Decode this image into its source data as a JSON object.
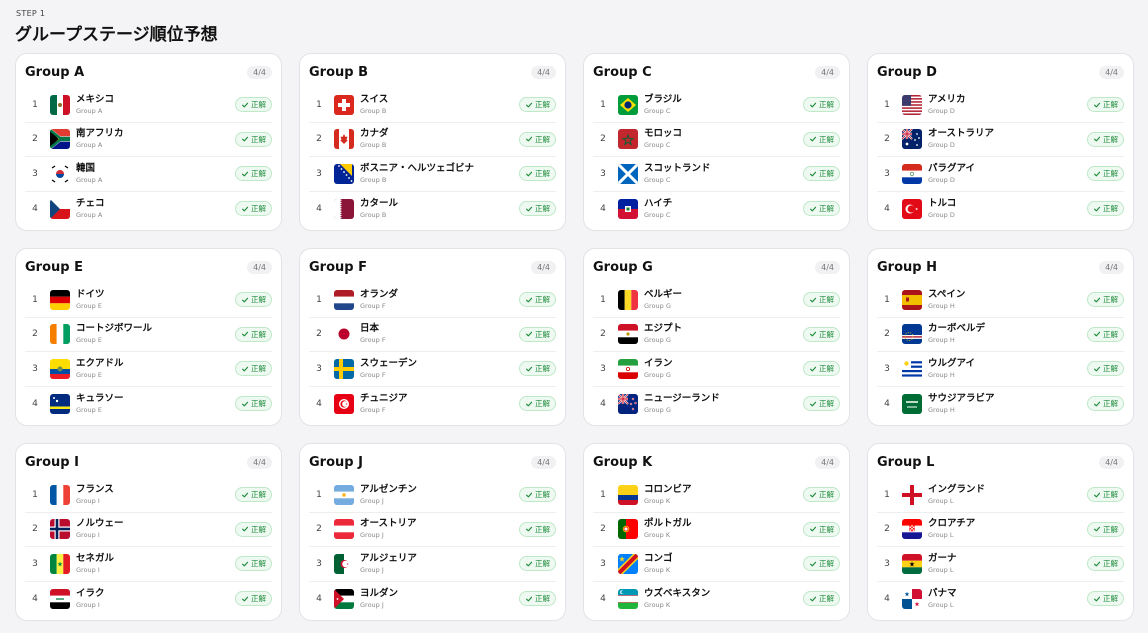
{
  "header": {
    "step": "STEP 1",
    "title": "グループステージ順位予想"
  },
  "status_colors": {
    "correct_text": "#1d8a3a",
    "correct_bg": "#eefaf1",
    "correct_border": "#bfe8c9"
  },
  "groups": [
    {
      "name": "Group A",
      "count": "4/4",
      "teams": [
        {
          "rank": "1",
          "name": "メキシコ",
          "group": "Group A",
          "flag": "mexico",
          "status": "正解"
        },
        {
          "rank": "2",
          "name": "南アフリカ",
          "group": "Group A",
          "flag": "south-africa",
          "status": "正解"
        },
        {
          "rank": "3",
          "name": "韓国",
          "group": "Group A",
          "flag": "south-korea",
          "status": "正解"
        },
        {
          "rank": "4",
          "name": "チェコ",
          "group": "Group A",
          "flag": "czechia",
          "status": "正解"
        }
      ]
    },
    {
      "name": "Group B",
      "count": "4/4",
      "teams": [
        {
          "rank": "1",
          "name": "スイス",
          "group": "Group B",
          "flag": "switzerland",
          "status": "正解"
        },
        {
          "rank": "2",
          "name": "カナダ",
          "group": "Group B",
          "flag": "canada",
          "status": "正解"
        },
        {
          "rank": "3",
          "name": "ボスニア・ヘルツェゴビナ",
          "group": "Group B",
          "flag": "bosnia",
          "status": "正解"
        },
        {
          "rank": "4",
          "name": "カタール",
          "group": "Group B",
          "flag": "qatar",
          "status": "正解"
        }
      ]
    },
    {
      "name": "Group C",
      "count": "4/4",
      "teams": [
        {
          "rank": "1",
          "name": "ブラジル",
          "group": "Group C",
          "flag": "brazil",
          "status": "正解"
        },
        {
          "rank": "2",
          "name": "モロッコ",
          "group": "Group C",
          "flag": "morocco",
          "status": "正解"
        },
        {
          "rank": "3",
          "name": "スコットランド",
          "group": "Group C",
          "flag": "scotland",
          "status": "正解"
        },
        {
          "rank": "4",
          "name": "ハイチ",
          "group": "Group C",
          "flag": "haiti",
          "status": "正解"
        }
      ]
    },
    {
      "name": "Group D",
      "count": "4/4",
      "teams": [
        {
          "rank": "1",
          "name": "アメリカ",
          "group": "Group D",
          "flag": "usa",
          "status": "正解"
        },
        {
          "rank": "2",
          "name": "オーストラリア",
          "group": "Group D",
          "flag": "australia",
          "status": "正解"
        },
        {
          "rank": "3",
          "name": "パラグアイ",
          "group": "Group D",
          "flag": "paraguay",
          "status": "正解"
        },
        {
          "rank": "4",
          "name": "トルコ",
          "group": "Group D",
          "flag": "turkey",
          "status": "正解"
        }
      ]
    },
    {
      "name": "Group E",
      "count": "4/4",
      "teams": [
        {
          "rank": "1",
          "name": "ドイツ",
          "group": "Group E",
          "flag": "germany",
          "status": "正解"
        },
        {
          "rank": "2",
          "name": "コートジボワール",
          "group": "Group E",
          "flag": "ivory-coast",
          "status": "正解"
        },
        {
          "rank": "3",
          "name": "エクアドル",
          "group": "Group E",
          "flag": "ecuador",
          "status": "正解"
        },
        {
          "rank": "4",
          "name": "キュラソー",
          "group": "Group E",
          "flag": "curacao",
          "status": "正解"
        }
      ]
    },
    {
      "name": "Group F",
      "count": "4/4",
      "teams": [
        {
          "rank": "1",
          "name": "オランダ",
          "group": "Group F",
          "flag": "netherlands",
          "status": "正解"
        },
        {
          "rank": "2",
          "name": "日本",
          "group": "Group F",
          "flag": "japan",
          "status": "正解"
        },
        {
          "rank": "3",
          "name": "スウェーデン",
          "group": "Group F",
          "flag": "sweden",
          "status": "正解"
        },
        {
          "rank": "4",
          "name": "チュニジア",
          "group": "Group F",
          "flag": "tunisia",
          "status": "正解"
        }
      ]
    },
    {
      "name": "Group G",
      "count": "4/4",
      "teams": [
        {
          "rank": "1",
          "name": "ベルギー",
          "group": "Group G",
          "flag": "belgium",
          "status": "正解"
        },
        {
          "rank": "2",
          "name": "エジプト",
          "group": "Group G",
          "flag": "egypt",
          "status": "正解"
        },
        {
          "rank": "3",
          "name": "イラン",
          "group": "Group G",
          "flag": "iran",
          "status": "正解"
        },
        {
          "rank": "4",
          "name": "ニュージーランド",
          "group": "Group G",
          "flag": "new-zealand",
          "status": "正解"
        }
      ]
    },
    {
      "name": "Group H",
      "count": "4/4",
      "teams": [
        {
          "rank": "1",
          "name": "スペイン",
          "group": "Group H",
          "flag": "spain",
          "status": "正解"
        },
        {
          "rank": "2",
          "name": "カーボベルデ",
          "group": "Group H",
          "flag": "cape-verde",
          "status": "正解"
        },
        {
          "rank": "3",
          "name": "ウルグアイ",
          "group": "Group H",
          "flag": "uruguay",
          "status": "正解"
        },
        {
          "rank": "4",
          "name": "サウジアラビア",
          "group": "Group H",
          "flag": "saudi-arabia",
          "status": "正解"
        }
      ]
    },
    {
      "name": "Group I",
      "count": "4/4",
      "teams": [
        {
          "rank": "1",
          "name": "フランス",
          "group": "Group I",
          "flag": "france",
          "status": "正解"
        },
        {
          "rank": "2",
          "name": "ノルウェー",
          "group": "Group I",
          "flag": "norway",
          "status": "正解"
        },
        {
          "rank": "3",
          "name": "セネガル",
          "group": "Group I",
          "flag": "senegal",
          "status": "正解"
        },
        {
          "rank": "4",
          "name": "イラク",
          "group": "Group I",
          "flag": "iraq",
          "status": "正解"
        }
      ]
    },
    {
      "name": "Group J",
      "count": "4/4",
      "teams": [
        {
          "rank": "1",
          "name": "アルゼンチン",
          "group": "Group J",
          "flag": "argentina",
          "status": "正解"
        },
        {
          "rank": "2",
          "name": "オーストリア",
          "group": "Group J",
          "flag": "austria",
          "status": "正解"
        },
        {
          "rank": "3",
          "name": "アルジェリア",
          "group": "Group J",
          "flag": "algeria",
          "status": "正解"
        },
        {
          "rank": "4",
          "name": "ヨルダン",
          "group": "Group J",
          "flag": "jordan",
          "status": "正解"
        }
      ]
    },
    {
      "name": "Group K",
      "count": "4/4",
      "teams": [
        {
          "rank": "1",
          "name": "コロンビア",
          "group": "Group K",
          "flag": "colombia",
          "status": "正解"
        },
        {
          "rank": "2",
          "name": "ポルトガル",
          "group": "Group K",
          "flag": "portugal",
          "status": "正解"
        },
        {
          "rank": "3",
          "name": "コンゴ",
          "group": "Group K",
          "flag": "dr-congo",
          "status": "正解"
        },
        {
          "rank": "4",
          "name": "ウズベキスタン",
          "group": "Group K",
          "flag": "uzbekistan",
          "status": "正解"
        }
      ]
    },
    {
      "name": "Group L",
      "count": "4/4",
      "teams": [
        {
          "rank": "1",
          "name": "イングランド",
          "group": "Group L",
          "flag": "england",
          "status": "正解"
        },
        {
          "rank": "2",
          "name": "クロアチア",
          "group": "Group L",
          "flag": "croatia",
          "status": "正解"
        },
        {
          "rank": "3",
          "name": "ガーナ",
          "group": "Group L",
          "flag": "ghana",
          "status": "正解"
        },
        {
          "rank": "4",
          "name": "パナマ",
          "group": "Group L",
          "flag": "panama",
          "status": "正解"
        }
      ]
    }
  ]
}
